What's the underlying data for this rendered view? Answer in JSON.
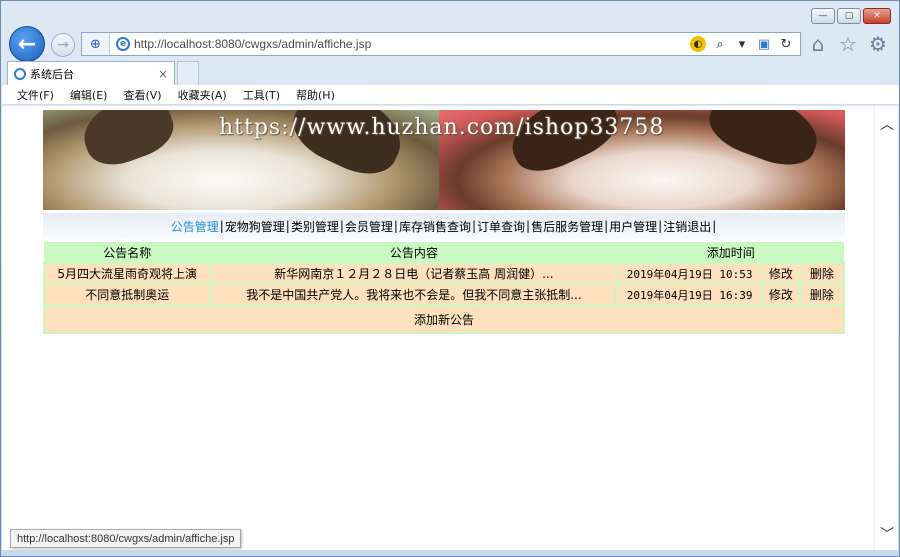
{
  "browser": {
    "address": "http://localhost:8080/cwgxs/admin/affiche.jsp",
    "tab_title": "系统后台",
    "tab_close": "×",
    "status_url": "http://localhost:8080/cwgxs/admin/affiche.jsp",
    "menu": [
      "文件(F)",
      "编辑(E)",
      "查看(V)",
      "收藏夹(A)",
      "工具(T)",
      "帮助(H)"
    ]
  },
  "banner": {
    "watermark": "https://www.huzhan.com/ishop33758"
  },
  "nav": {
    "items": [
      "公告管理",
      "宠物狗管理",
      "类别管理",
      "会员管理",
      "库存销售查询",
      "订单查询",
      "售后服务管理",
      "用户管理",
      "注销退出"
    ],
    "separator": "|"
  },
  "table": {
    "headers": [
      "公告名称",
      "公告内容",
      "添加时间"
    ],
    "rows": [
      {
        "name": "5月四大流星雨奇观将上演",
        "content": "新华网南京１２月２８日电（记者蔡玉高 周润健）...",
        "time": "2019年04月19日 10:53",
        "edit": "修改",
        "delete": "删除"
      },
      {
        "name": "不同意抵制奥运",
        "content": "我不是中国共产党人。我将来也不会是。但我不同意主张抵制...",
        "time": "2019年04月19日 16:39",
        "edit": "修改",
        "delete": "删除"
      }
    ],
    "add_label": "添加新公告"
  }
}
